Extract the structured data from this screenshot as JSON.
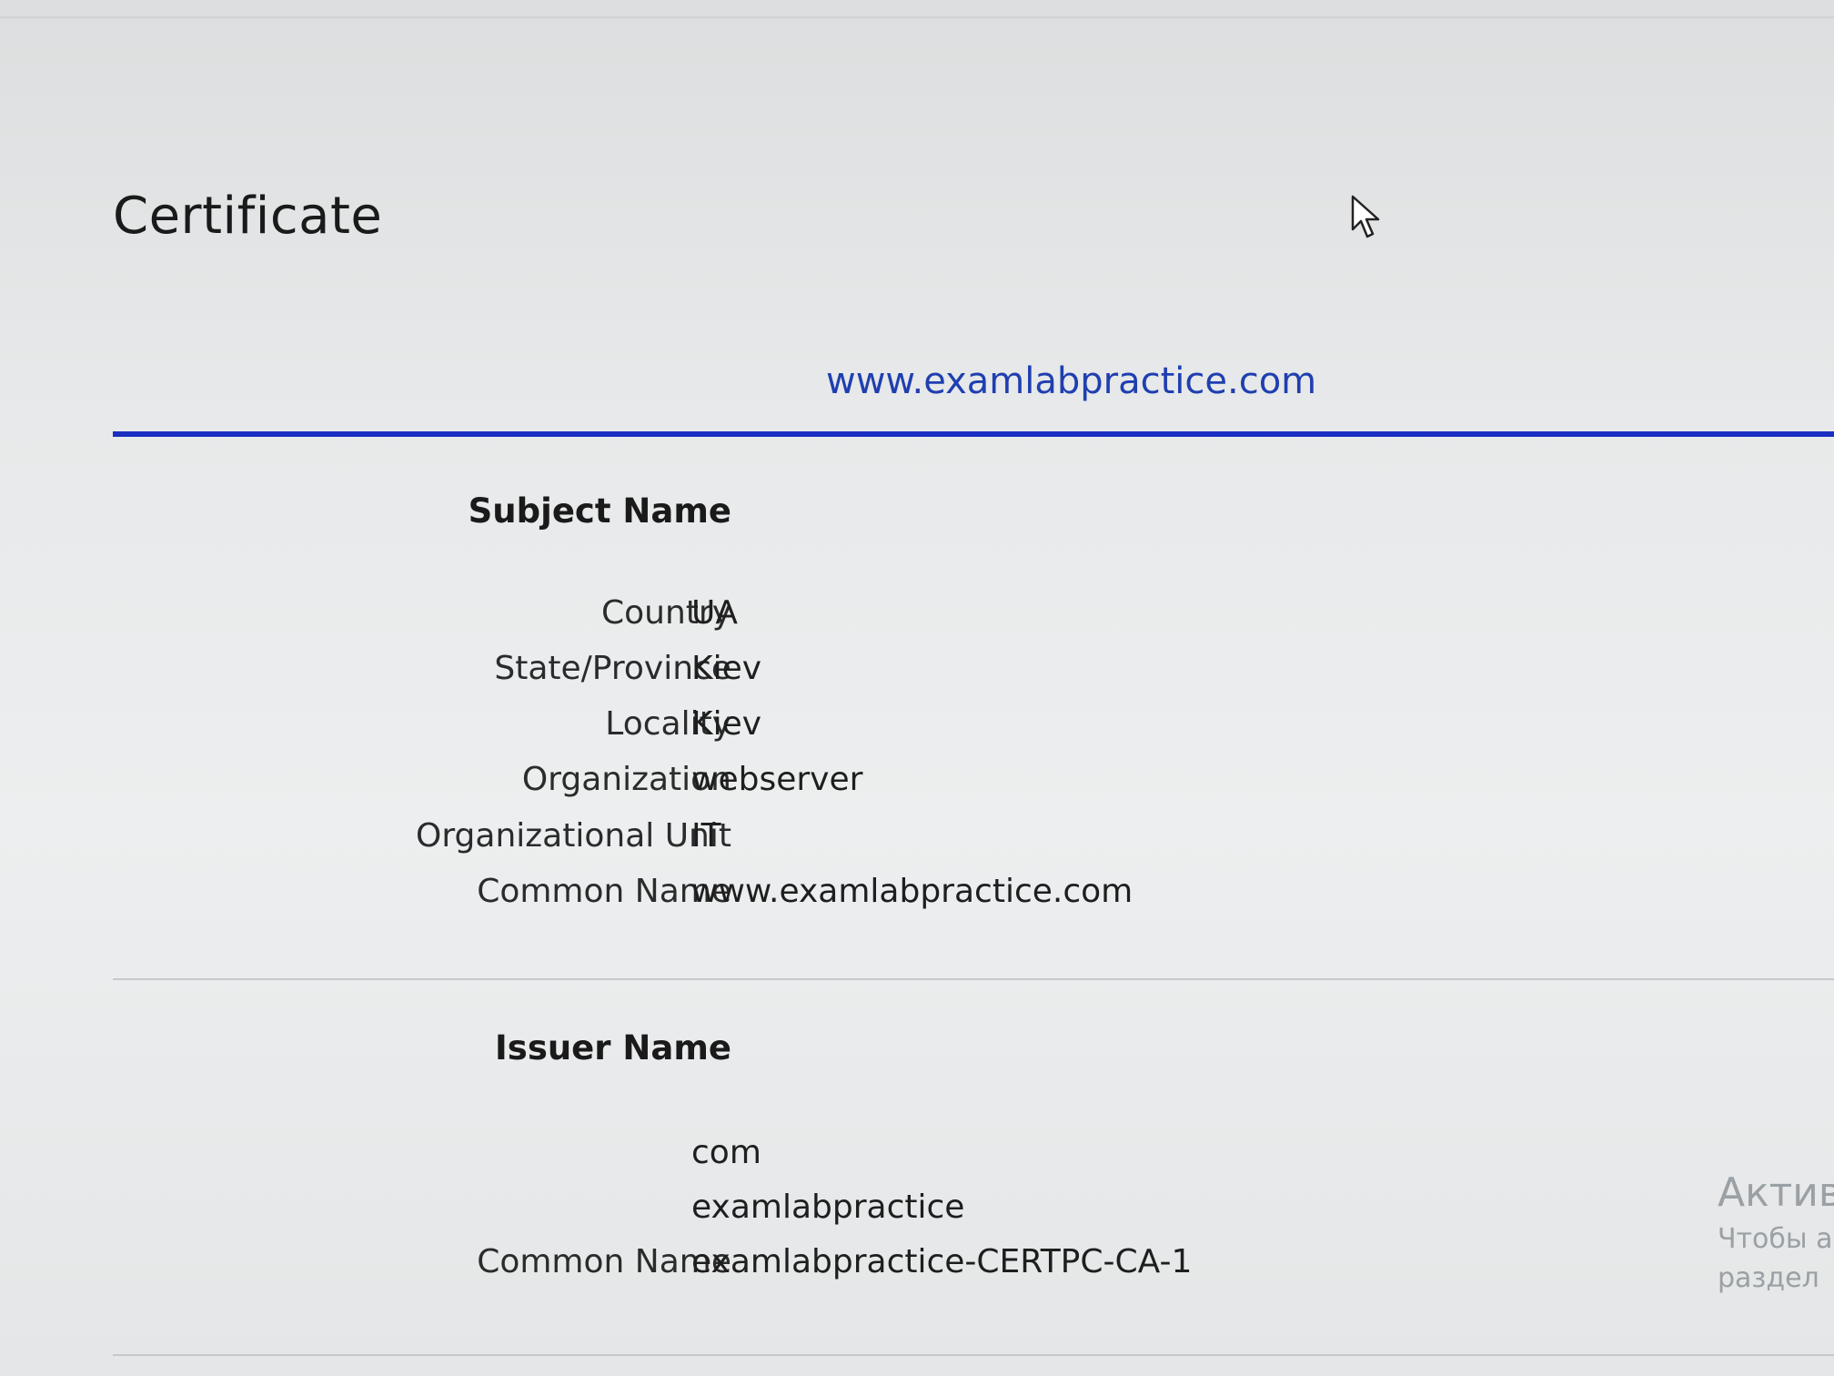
{
  "page": {
    "title": "Certificate"
  },
  "tab": {
    "label": "www.examlabpractice.com"
  },
  "subject": {
    "heading": "Subject Name",
    "fields": [
      {
        "label": "Country",
        "value": "UA"
      },
      {
        "label": "State/Province",
        "value": "Kiev"
      },
      {
        "label": "Locality",
        "value": "Kiev"
      },
      {
        "label": "Organization",
        "value": "webserver"
      },
      {
        "label": "Organizational Unit",
        "value": "IT"
      },
      {
        "label": "Common Name",
        "value": "www.examlabpractice.com"
      }
    ]
  },
  "issuer": {
    "heading": "Issuer Name",
    "fields": [
      {
        "label": "",
        "value": "com"
      },
      {
        "label": "",
        "value": "examlabpractice"
      },
      {
        "label": "Common Name",
        "value": "examlabpractice-CERTPC-CA-1"
      }
    ]
  },
  "watermark": {
    "line1": "Актив",
    "line2": "Чтобы а",
    "line3": "раздел"
  },
  "icons": {
    "cursor": "mouse-pointer-icon"
  },
  "colors": {
    "tab_text": "#1f3fb0",
    "tab_underline": "#1a2fc1"
  }
}
